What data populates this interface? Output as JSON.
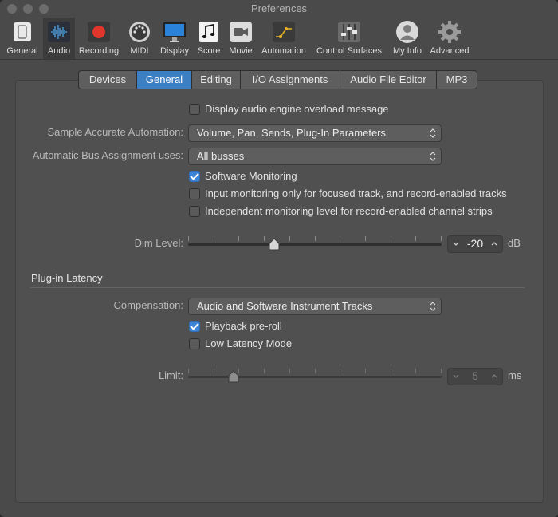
{
  "window": {
    "title": "Preferences"
  },
  "toolbar": {
    "items": [
      {
        "label": "General",
        "icon": "general-icon"
      },
      {
        "label": "Audio",
        "icon": "audio-waveform-icon",
        "active": true
      },
      {
        "label": "Recording",
        "icon": "record-icon"
      },
      {
        "label": "MIDI",
        "icon": "midi-icon"
      },
      {
        "label": "Display",
        "icon": "display-icon"
      },
      {
        "label": "Score",
        "icon": "score-icon"
      },
      {
        "label": "Movie",
        "icon": "movie-icon"
      },
      {
        "label": "Automation",
        "icon": "automation-icon"
      },
      {
        "label": "Control Surfaces",
        "icon": "control-surfaces-icon"
      },
      {
        "label": "My Info",
        "icon": "user-icon"
      },
      {
        "label": "Advanced",
        "icon": "gear-icon"
      }
    ]
  },
  "tabs": [
    {
      "label": "Devices"
    },
    {
      "label": "General",
      "active": true
    },
    {
      "label": "Editing"
    },
    {
      "label": "I/O Assignments"
    },
    {
      "label": "Audio File Editor"
    },
    {
      "label": "MP3"
    }
  ],
  "general": {
    "overload_label": "Display audio engine overload message",
    "overload_checked": false,
    "sample_accurate_label": "Sample Accurate Automation:",
    "sample_accurate_value": "Volume, Pan, Sends, Plug-In Parameters",
    "bus_label": "Automatic Bus Assignment uses:",
    "bus_value": "All busses",
    "software_monitoring_label": "Software Monitoring",
    "software_monitoring_checked": true,
    "input_monitoring_label": "Input monitoring only for focused track, and record-enabled tracks",
    "input_monitoring_checked": false,
    "independent_label": "Independent monitoring level for record-enabled channel strips",
    "independent_checked": false,
    "dim_label": "Dim Level:",
    "dim_value": "-20",
    "dim_unit": "dB",
    "dim_fraction": 0.34
  },
  "latency": {
    "title": "Plug-in Latency",
    "compensation_label": "Compensation:",
    "compensation_value": "Audio and Software Instrument Tracks",
    "preroll_label": "Playback pre-roll",
    "preroll_checked": true,
    "low_latency_label": "Low Latency Mode",
    "low_latency_checked": false,
    "limit_label": "Limit:",
    "limit_value": "5",
    "limit_unit": "ms",
    "limit_fraction": 0.18
  },
  "colors": {
    "accent": "#3d7fc3",
    "checkbox_on": "#3d84d6",
    "record": "#e0362c"
  }
}
